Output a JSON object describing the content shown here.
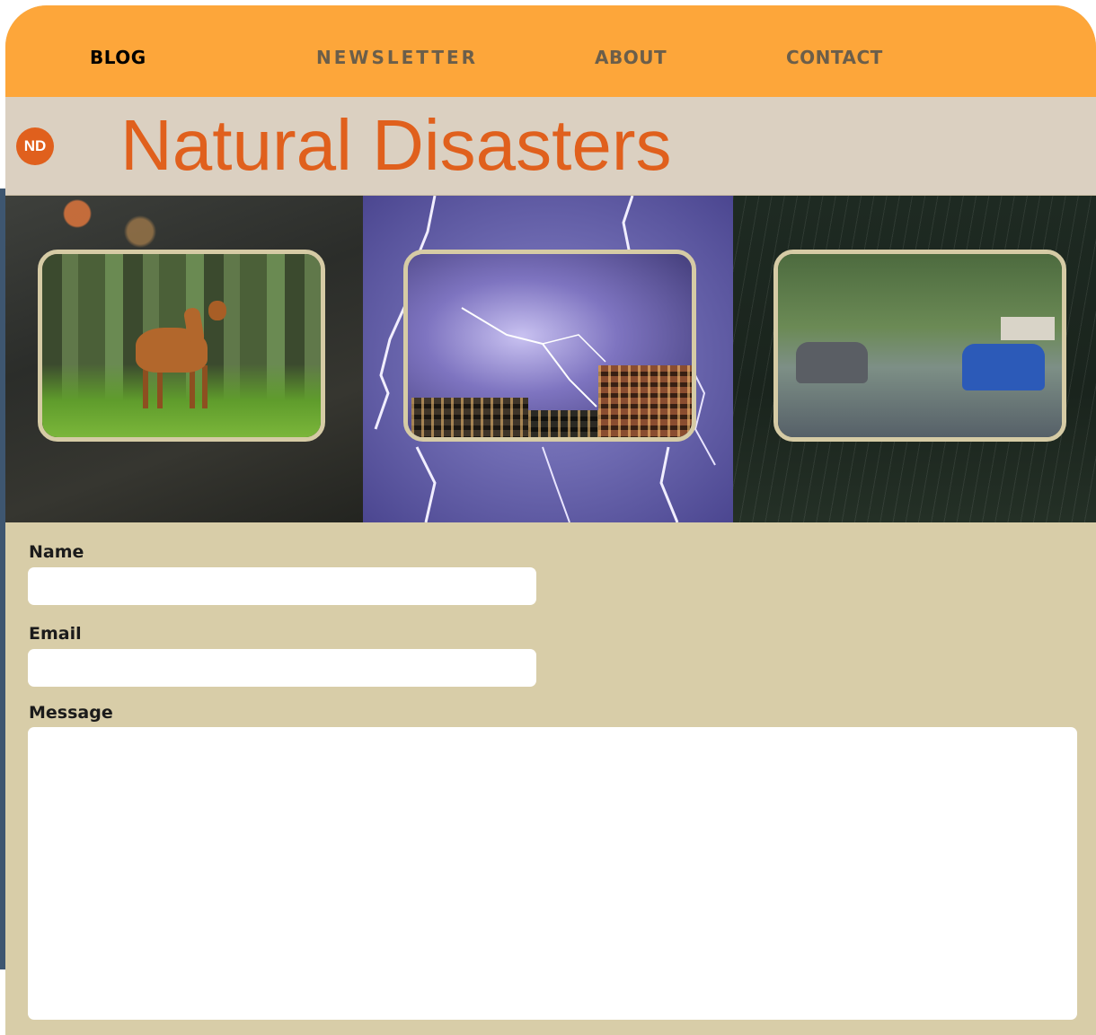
{
  "nav": {
    "items": [
      {
        "label": "BLOG",
        "active": true
      },
      {
        "label": "NEWSLETTER",
        "active": false
      },
      {
        "label": "ABOUT",
        "active": false
      },
      {
        "label": "CONTACT",
        "active": false
      }
    ]
  },
  "header": {
    "logo_text": "ND",
    "title": "Natural Disasters"
  },
  "form": {
    "name_label": "Name",
    "name_value": "",
    "email_label": "Email",
    "email_value": "",
    "message_label": "Message",
    "message_value": ""
  },
  "colors": {
    "nav_bg": "#fda63a",
    "title": "#e0601d",
    "form_bg": "#d8cda8",
    "frame_border": "#d6cba5"
  }
}
